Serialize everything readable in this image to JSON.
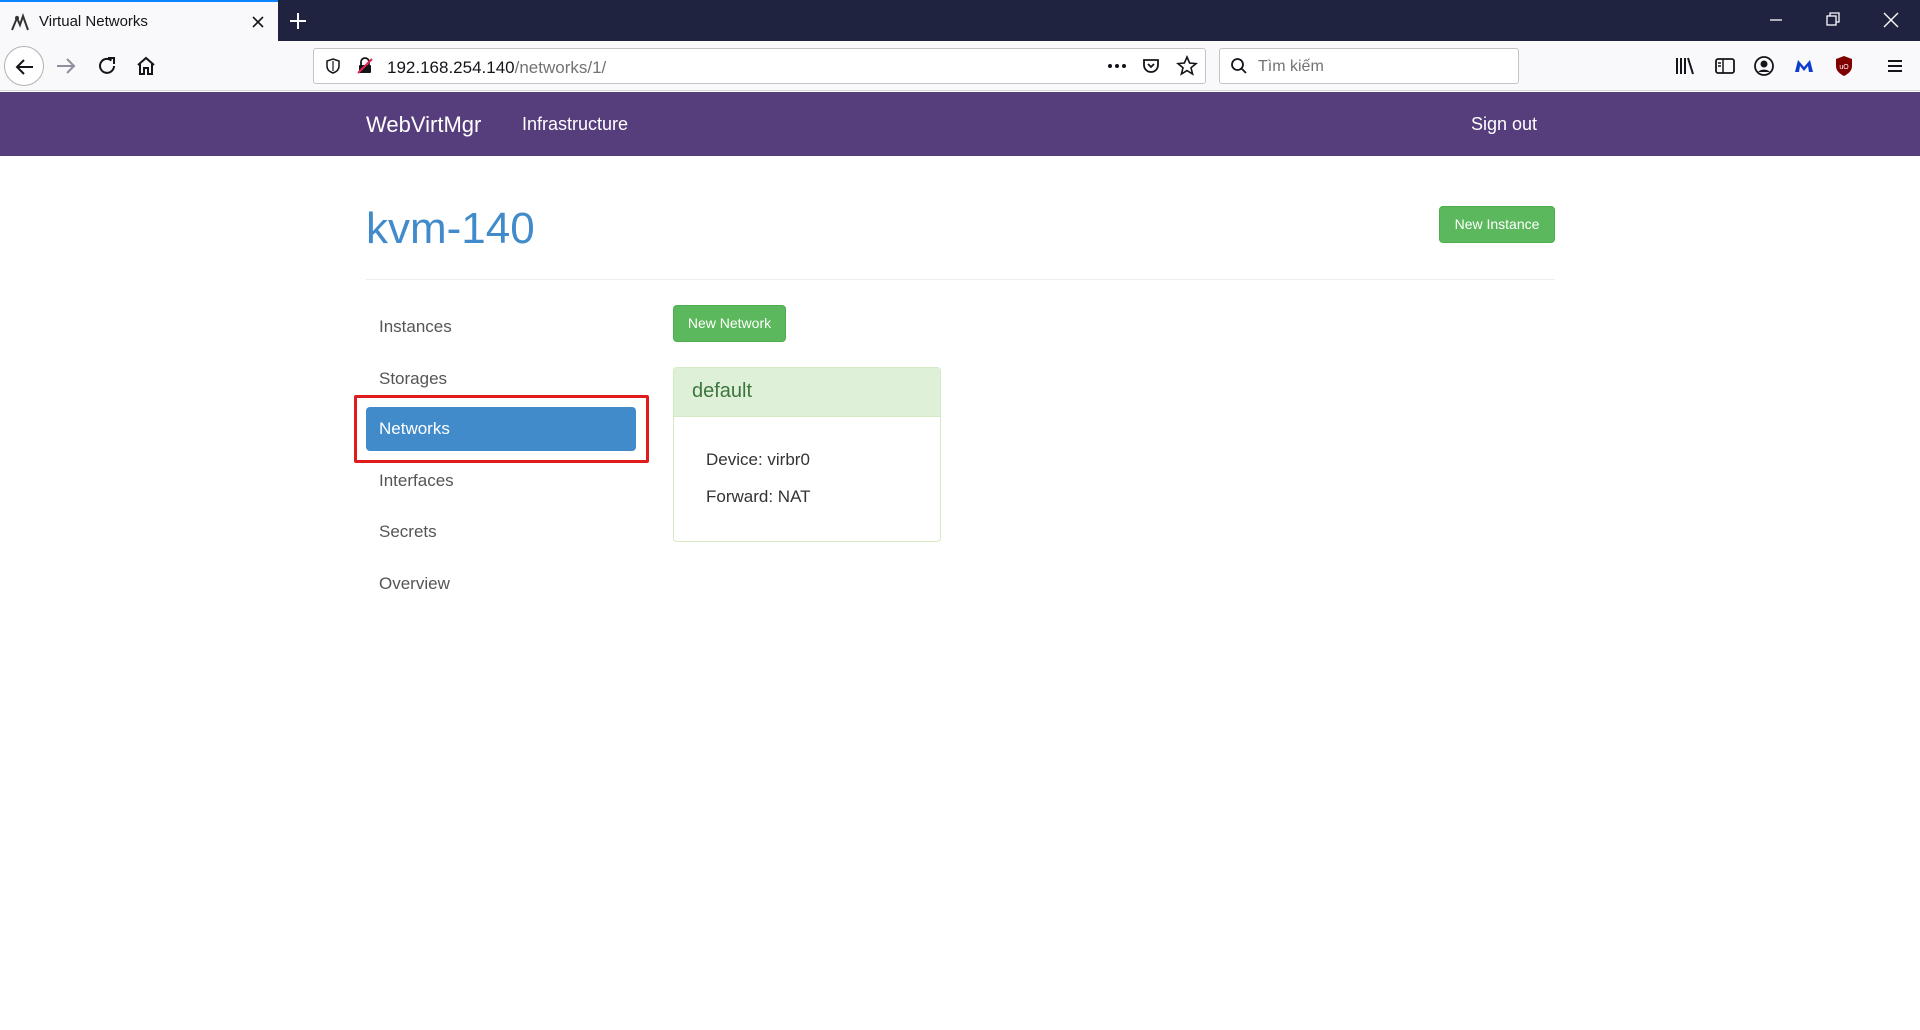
{
  "browser": {
    "tab_title": "Virtual Networks",
    "url_host": "192.168.254.140",
    "url_path": "/networks/1/",
    "search_placeholder": "Tìm kiếm"
  },
  "navbar": {
    "brand": "WebVirtMgr",
    "infrastructure": "Infrastructure",
    "sign_out": "Sign out",
    "background_color": "#563d7c"
  },
  "page": {
    "title": "kvm-140",
    "new_instance_label": "New Instance",
    "new_network_label": "New Network"
  },
  "sidebar": {
    "items": [
      {
        "label": "Instances",
        "active": false
      },
      {
        "label": "Storages",
        "active": false
      },
      {
        "label": "Networks",
        "active": true
      },
      {
        "label": "Interfaces",
        "active": false
      },
      {
        "label": "Secrets",
        "active": false
      },
      {
        "label": "Overview",
        "active": false
      }
    ]
  },
  "networks": [
    {
      "name": "default",
      "device": "Device: virbr0",
      "forward": "Forward: NAT"
    }
  ],
  "colors": {
    "accent": "#428bca",
    "success": "#5cb85c",
    "highlight": "#e01b1b"
  }
}
